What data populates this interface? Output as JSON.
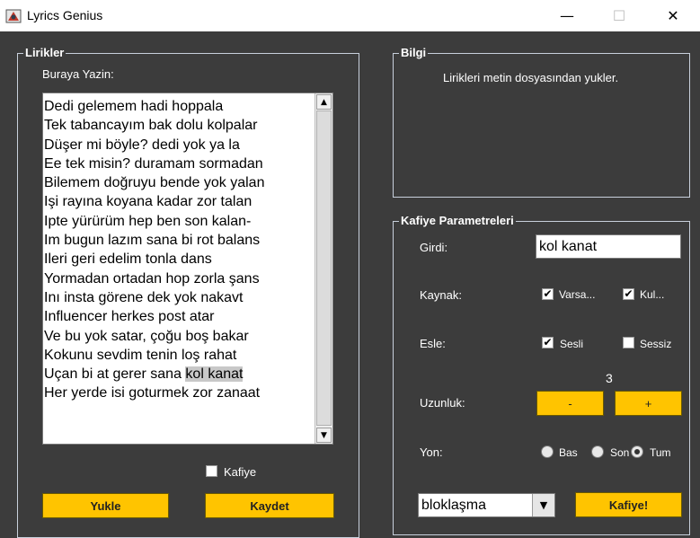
{
  "window": {
    "title": "Lyrics Genius",
    "minimize_glyph": "—",
    "maximize_glyph": "☐",
    "close_glyph": "✕"
  },
  "lyrics_panel": {
    "legend": "Lirikler",
    "prompt": "Buraya Yazin:",
    "lines": [
      "Dedi gelemem hadi hoppala",
      "Tek tabancayım bak dolu kolpalar",
      "Düşer mi böyle? dedi yok ya la",
      "Ee tek misin? duramam sormadan",
      "Bilemem doğruyu bende yok yalan",
      "Işi rayına koyana kadar zor talan",
      "Ipte yürürüm hep ben son kalan-",
      "Im bugun lazım sana bi rot balans",
      "Ileri geri edelim tonla dans",
      "Yormadan ortadan hop zorla şans",
      "Inı insta görene dek yok nakavt",
      "Influencer herkes post atar",
      "Ve bu yok satar, çoğu boş bakar",
      "Kokunu sevdim tenin loş rahat",
      "Uçan bi at gerer sana ",
      "Her yerde isi goturmek zor zanaat"
    ],
    "highlighted_text": "kol kanat",
    "kafiye_checkbox_label": "Kafiye",
    "kafiye_checked": false,
    "load_button": "Yukle",
    "save_button": "Kaydet"
  },
  "info_panel": {
    "legend": "Bilgi",
    "message": "Lirikleri metin dosyasından yukler."
  },
  "rhyme_params": {
    "legend": "Kafiye Parametreleri",
    "input_label": "Girdi:",
    "input_value": "kol kanat",
    "source_label": "Kaynak:",
    "source_options": [
      {
        "label": "Varsa...",
        "checked": true
      },
      {
        "label": "Kul...",
        "checked": true
      }
    ],
    "match_label": "Esle:",
    "match_options": [
      {
        "label": "Sesli",
        "checked": true
      },
      {
        "label": "Sessiz",
        "checked": false
      }
    ],
    "length_value": "3",
    "length_label": "Uzunluk:",
    "minus_label": "-",
    "plus_label": "+",
    "direction_label": "Yon:",
    "direction_options": [
      {
        "label": "Bas",
        "selected": false
      },
      {
        "label": "Son",
        "selected": false
      },
      {
        "label": "Tum",
        "selected": true
      }
    ],
    "mode_select_value": "bloklaşma",
    "rhyme_button": "Kafiye!"
  },
  "colors": {
    "background": "#3c3c3c",
    "button_yellow": "#ffc400",
    "border": "#c8d0dc"
  }
}
